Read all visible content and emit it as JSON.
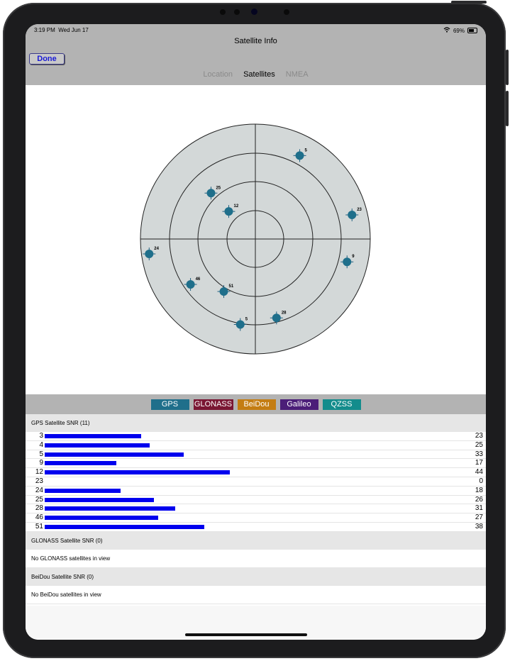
{
  "status": {
    "time": "3:19 PM",
    "date": "Wed Jun 17",
    "battery": "69%",
    "battery_level": 0.69,
    "wifi_icon": "wifi-icon"
  },
  "nav": {
    "title": "Satellite Info",
    "done_label": "Done",
    "tabs": [
      {
        "label": "Location",
        "active": false
      },
      {
        "label": "Satellites",
        "active": true
      },
      {
        "label": "NMEA",
        "active": false
      }
    ]
  },
  "sky_plot": {
    "satellites": [
      {
        "id": "25",
        "az": 316,
        "el": 40
      },
      {
        "id": "5",
        "az": 28,
        "el": 16
      },
      {
        "id": "12",
        "az": 316,
        "el": 60
      },
      {
        "id": "23",
        "az": 76,
        "el": 12
      },
      {
        "id": "24",
        "az": 262,
        "el": 6
      },
      {
        "id": "9",
        "az": 104,
        "el": 16
      },
      {
        "id": "46",
        "az": 235,
        "el": 28
      },
      {
        "id": "51",
        "az": 211,
        "el": 42
      },
      {
        "id": "5",
        "az": 190,
        "el": 22
      },
      {
        "id": "28",
        "az": 165,
        "el": 26
      }
    ]
  },
  "filters": [
    {
      "label": "GPS",
      "color": "#1f6f8b",
      "width": 54
    },
    {
      "label": "GLONASS",
      "color": "#7a1633",
      "width": 56
    },
    {
      "label": "BeiDou",
      "color": "#c47d12",
      "width": 54
    },
    {
      "label": "Galileo",
      "color": "#4b1e78",
      "width": 54
    },
    {
      "label": "QZSS",
      "color": "#138c8c",
      "width": 54
    }
  ],
  "gps": {
    "header": "GPS Satellite SNR (11)",
    "rows": [
      {
        "id": "3",
        "snr": 23
      },
      {
        "id": "4",
        "snr": 25
      },
      {
        "id": "5",
        "snr": 33
      },
      {
        "id": "9",
        "snr": 17
      },
      {
        "id": "12",
        "snr": 44
      },
      {
        "id": "23",
        "snr": 0
      },
      {
        "id": "24",
        "snr": 18
      },
      {
        "id": "25",
        "snr": 26
      },
      {
        "id": "28",
        "snr": 31
      },
      {
        "id": "46",
        "snr": 27
      },
      {
        "id": "51",
        "snr": 38
      }
    ]
  },
  "glonass": {
    "header": "GLONASS Satellite SNR (0)",
    "empty": "No GLONASS satellites in view"
  },
  "beidou": {
    "header": "BeiDou Satellite SNR (0)",
    "empty": "No BeiDou satellites in view"
  }
}
